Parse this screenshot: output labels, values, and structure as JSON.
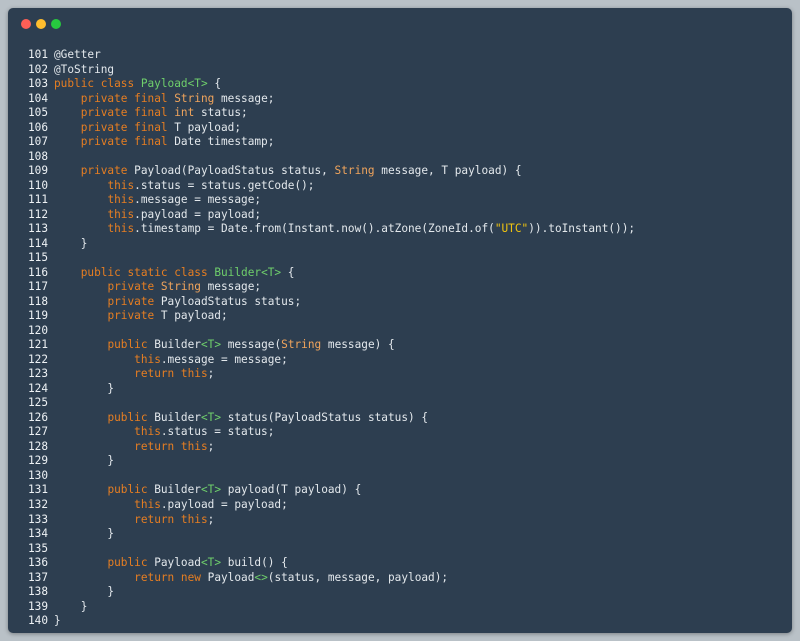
{
  "window": {
    "controls": [
      {
        "name": "close-button",
        "color": "#ff5f56"
      },
      {
        "name": "minimize-button",
        "color": "#ffbd2e"
      },
      {
        "name": "zoom-button",
        "color": "#27c93f"
      }
    ]
  },
  "editor": {
    "lines": [
      {
        "n": "101",
        "t": [
          [
            "p",
            "@Getter"
          ]
        ]
      },
      {
        "n": "102",
        "t": [
          [
            "p",
            "@ToString"
          ]
        ]
      },
      {
        "n": "103",
        "t": [
          [
            "k",
            "public class "
          ],
          [
            "c",
            "Payload"
          ],
          [
            "g",
            "<T>"
          ],
          [
            "p",
            " {"
          ]
        ]
      },
      {
        "n": "104",
        "t": [
          [
            "p",
            "    "
          ],
          [
            "k",
            "private final "
          ],
          [
            "y",
            "String"
          ],
          [
            "p",
            " message;"
          ]
        ]
      },
      {
        "n": "105",
        "t": [
          [
            "p",
            "    "
          ],
          [
            "k",
            "private final "
          ],
          [
            "y",
            "int"
          ],
          [
            "p",
            " status;"
          ]
        ]
      },
      {
        "n": "106",
        "t": [
          [
            "p",
            "    "
          ],
          [
            "k",
            "private final "
          ],
          [
            "p",
            "T payload;"
          ]
        ]
      },
      {
        "n": "107",
        "t": [
          [
            "p",
            "    "
          ],
          [
            "k",
            "private final "
          ],
          [
            "p",
            "Date timestamp;"
          ]
        ]
      },
      {
        "n": "108",
        "t": []
      },
      {
        "n": "109",
        "t": [
          [
            "p",
            "    "
          ],
          [
            "k",
            "private "
          ],
          [
            "p",
            "Payload(PayloadStatus status, "
          ],
          [
            "y",
            "String"
          ],
          [
            "p",
            " message, T payload) {"
          ]
        ]
      },
      {
        "n": "110",
        "t": [
          [
            "p",
            "        "
          ],
          [
            "k",
            "this"
          ],
          [
            "p",
            ".status = status.getCode();"
          ]
        ]
      },
      {
        "n": "111",
        "t": [
          [
            "p",
            "        "
          ],
          [
            "k",
            "this"
          ],
          [
            "p",
            ".message = message;"
          ]
        ]
      },
      {
        "n": "112",
        "t": [
          [
            "p",
            "        "
          ],
          [
            "k",
            "this"
          ],
          [
            "p",
            ".payload = payload;"
          ]
        ]
      },
      {
        "n": "113",
        "t": [
          [
            "p",
            "        "
          ],
          [
            "k",
            "this"
          ],
          [
            "p",
            ".timestamp = Date.from(Instant.now().atZone(ZoneId.of("
          ],
          [
            "s",
            "\"UTC\""
          ],
          [
            "p",
            ")).toInstant());"
          ]
        ]
      },
      {
        "n": "114",
        "t": [
          [
            "p",
            "    }"
          ]
        ]
      },
      {
        "n": "115",
        "t": []
      },
      {
        "n": "116",
        "t": [
          [
            "p",
            "    "
          ],
          [
            "k",
            "public static class "
          ],
          [
            "c",
            "Builder"
          ],
          [
            "g",
            "<T>"
          ],
          [
            "p",
            " {"
          ]
        ]
      },
      {
        "n": "117",
        "t": [
          [
            "p",
            "        "
          ],
          [
            "k",
            "private "
          ],
          [
            "y",
            "String"
          ],
          [
            "p",
            " message;"
          ]
        ]
      },
      {
        "n": "118",
        "t": [
          [
            "p",
            "        "
          ],
          [
            "k",
            "private "
          ],
          [
            "p",
            "PayloadStatus status;"
          ]
        ]
      },
      {
        "n": "119",
        "t": [
          [
            "p",
            "        "
          ],
          [
            "k",
            "private "
          ],
          [
            "p",
            "T payload;"
          ]
        ]
      },
      {
        "n": "120",
        "t": []
      },
      {
        "n": "121",
        "t": [
          [
            "p",
            "        "
          ],
          [
            "k",
            "public "
          ],
          [
            "p",
            "Builder"
          ],
          [
            "g",
            "<T>"
          ],
          [
            "p",
            " message("
          ],
          [
            "y",
            "String"
          ],
          [
            "p",
            " message) {"
          ]
        ]
      },
      {
        "n": "122",
        "t": [
          [
            "p",
            "            "
          ],
          [
            "k",
            "this"
          ],
          [
            "p",
            ".message = message;"
          ]
        ]
      },
      {
        "n": "123",
        "t": [
          [
            "p",
            "            "
          ],
          [
            "k",
            "return this"
          ],
          [
            "p",
            ";"
          ]
        ]
      },
      {
        "n": "124",
        "t": [
          [
            "p",
            "        }"
          ]
        ]
      },
      {
        "n": "125",
        "t": []
      },
      {
        "n": "126",
        "t": [
          [
            "p",
            "        "
          ],
          [
            "k",
            "public "
          ],
          [
            "p",
            "Builder"
          ],
          [
            "g",
            "<T>"
          ],
          [
            "p",
            " status(PayloadStatus status) {"
          ]
        ]
      },
      {
        "n": "127",
        "t": [
          [
            "p",
            "            "
          ],
          [
            "k",
            "this"
          ],
          [
            "p",
            ".status = status;"
          ]
        ]
      },
      {
        "n": "128",
        "t": [
          [
            "p",
            "            "
          ],
          [
            "k",
            "return this"
          ],
          [
            "p",
            ";"
          ]
        ]
      },
      {
        "n": "129",
        "t": [
          [
            "p",
            "        }"
          ]
        ]
      },
      {
        "n": "130",
        "t": []
      },
      {
        "n": "131",
        "t": [
          [
            "p",
            "        "
          ],
          [
            "k",
            "public "
          ],
          [
            "p",
            "Builder"
          ],
          [
            "g",
            "<T>"
          ],
          [
            "p",
            " payload(T payload) {"
          ]
        ]
      },
      {
        "n": "132",
        "t": [
          [
            "p",
            "            "
          ],
          [
            "k",
            "this"
          ],
          [
            "p",
            ".payload = payload;"
          ]
        ]
      },
      {
        "n": "133",
        "t": [
          [
            "p",
            "            "
          ],
          [
            "k",
            "return this"
          ],
          [
            "p",
            ";"
          ]
        ]
      },
      {
        "n": "134",
        "t": [
          [
            "p",
            "        }"
          ]
        ]
      },
      {
        "n": "135",
        "t": []
      },
      {
        "n": "136",
        "t": [
          [
            "p",
            "        "
          ],
          [
            "k",
            "public "
          ],
          [
            "p",
            "Payload"
          ],
          [
            "g",
            "<T>"
          ],
          [
            "p",
            " build() {"
          ]
        ]
      },
      {
        "n": "137",
        "t": [
          [
            "p",
            "            "
          ],
          [
            "k",
            "return new "
          ],
          [
            "p",
            "Payload"
          ],
          [
            "g",
            "<>"
          ],
          [
            "p",
            "(status, message, payload);"
          ]
        ]
      },
      {
        "n": "138",
        "t": [
          [
            "p",
            "        }"
          ]
        ]
      },
      {
        "n": "139",
        "t": [
          [
            "p",
            "    }"
          ]
        ]
      },
      {
        "n": "140",
        "t": [
          [
            "p",
            "}"
          ]
        ]
      }
    ]
  }
}
